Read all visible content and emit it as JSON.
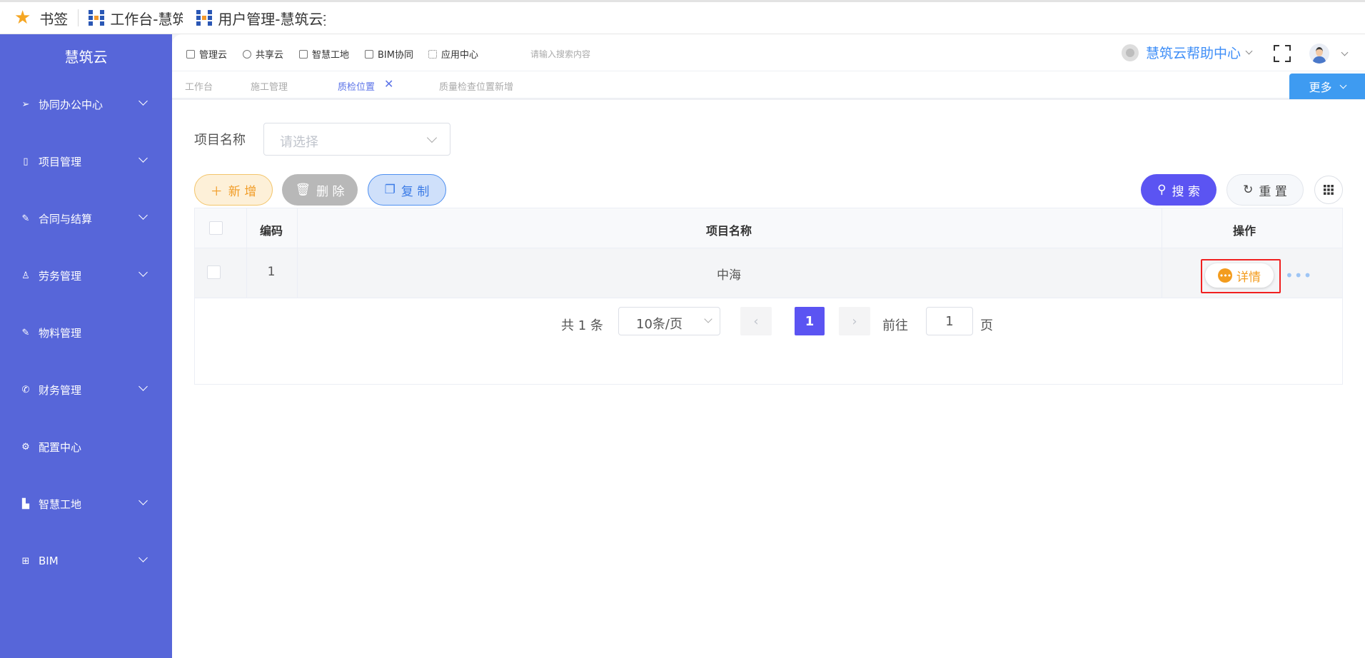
{
  "bookmarks": {
    "items": [
      {
        "label": "书签"
      },
      {
        "label": "工作台-慧筑云-智"
      },
      {
        "label": "用户管理-慧筑云指"
      }
    ]
  },
  "sidebar": {
    "brand": "慧筑云",
    "items": [
      {
        "label": "协同办公中心",
        "icon": "send-icon",
        "has_children": true
      },
      {
        "label": "项目管理",
        "icon": "book-icon",
        "has_children": true
      },
      {
        "label": "合同与结算",
        "icon": "edit-doc-icon",
        "has_children": true
      },
      {
        "label": "劳务管理",
        "icon": "worker-icon",
        "has_children": true
      },
      {
        "label": "物料管理",
        "icon": "edit-doc-icon",
        "has_children": false
      },
      {
        "label": "财务管理",
        "icon": "phone-icon",
        "has_children": true
      },
      {
        "label": "配置中心",
        "icon": "gear-icon",
        "has_children": false
      },
      {
        "label": "智慧工地",
        "icon": "chart-icon",
        "has_children": true
      },
      {
        "label": "BIM",
        "icon": "grid-icon",
        "has_children": true
      }
    ]
  },
  "topnav": {
    "items": [
      {
        "label": "管理云"
      },
      {
        "label": "共享云"
      },
      {
        "label": "智慧工地"
      },
      {
        "label": "BIM协同"
      },
      {
        "label": "应用中心"
      }
    ],
    "search_placeholder": "请输入搜索内容",
    "help": "慧筑云帮助中心"
  },
  "tabs": {
    "items": [
      {
        "label": "工作台"
      },
      {
        "label": "施工管理"
      },
      {
        "label": "质检位置",
        "active": true
      },
      {
        "label": "质量检查位置新增"
      }
    ],
    "more": "更多"
  },
  "filter": {
    "label": "项目名称",
    "placeholder": "请选择"
  },
  "toolbar": {
    "add": "新 增",
    "delete": "删 除",
    "copy": "复 制",
    "search": "搜 索",
    "reset": "重 置"
  },
  "table": {
    "columns": [
      "编码",
      "项目名称",
      "操作"
    ],
    "rows": [
      {
        "code": "1",
        "name": "中海",
        "action": "详情"
      }
    ]
  },
  "pagination": {
    "total": "共 1 条",
    "page_size": "10条/页",
    "current_page": "1",
    "goto_label": "前往",
    "goto_value": "1",
    "page_label": "页"
  },
  "colors": {
    "sidebar": "#5766d9",
    "primary": "#5b54f2",
    "accent_orange": "#f39c1e",
    "accent_blue": "#3e9bf1"
  }
}
